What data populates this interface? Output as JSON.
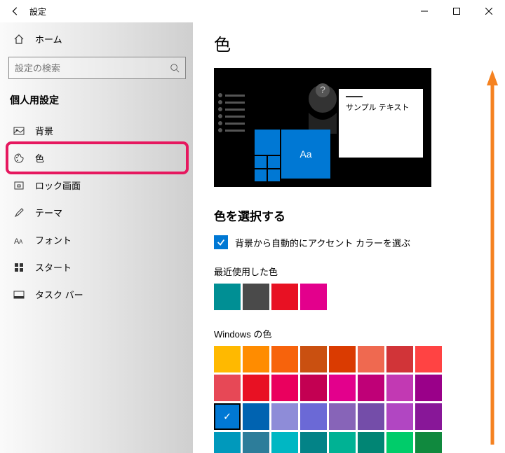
{
  "titlebar": {
    "title": "設定"
  },
  "sidebar": {
    "home": "ホーム",
    "search_placeholder": "設定の検索",
    "section": "個人用設定",
    "items": [
      {
        "label": "背景",
        "icon": "picture"
      },
      {
        "label": "色",
        "icon": "palette",
        "selected": true
      },
      {
        "label": "ロック画面",
        "icon": "lock"
      },
      {
        "label": "テーマ",
        "icon": "brush"
      },
      {
        "label": "フォント",
        "icon": "font"
      },
      {
        "label": "スタート",
        "icon": "start"
      },
      {
        "label": "タスク バー",
        "icon": "taskbar"
      }
    ]
  },
  "content": {
    "title": "色",
    "preview_sample": "サンプル テキスト",
    "preview_tile": "Aa",
    "choose_heading": "色を選択する",
    "auto_checkbox_label": "背景から自動的にアクセント カラーを選ぶ",
    "auto_checkbox_checked": true,
    "recent_label": "最近使用した色",
    "recent_colors": [
      "#008f94",
      "#4a4a4a",
      "#e81123",
      "#e3008c"
    ],
    "windows_colors_label": "Windows の色",
    "windows_colors": [
      "#ffb900",
      "#ff8c00",
      "#f7630c",
      "#ca5010",
      "#da3b01",
      "#ef6950",
      "#d13438",
      "#ff4343",
      "#e74856",
      "#e81123",
      "#ea005e",
      "#c30052",
      "#e3008c",
      "#bf0077",
      "#c239b3",
      "#9a0089",
      "#0078d4",
      "#0063b1",
      "#8e8cd8",
      "#6b69d6",
      "#8764b8",
      "#744da9",
      "#b146c2",
      "#881798",
      "#0099bc",
      "#2d7d9a",
      "#00b7c3",
      "#038387",
      "#00b294",
      "#018574",
      "#00cc6a",
      "#10893e"
    ],
    "selected_windows_color_index": 16
  }
}
